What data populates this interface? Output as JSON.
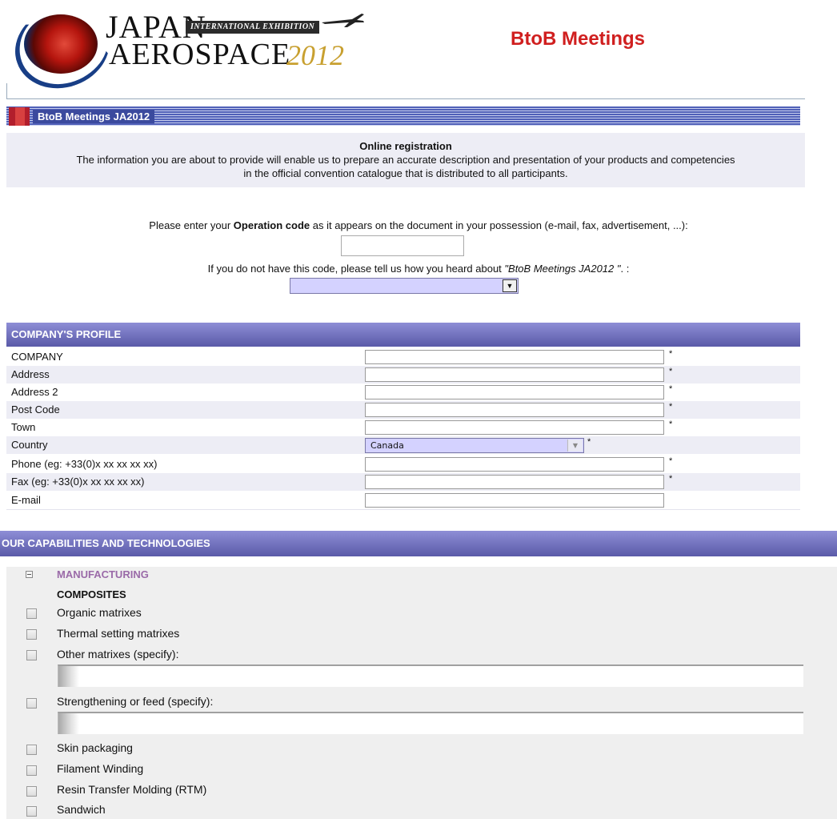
{
  "header": {
    "logo_japan": "JAPAN",
    "logo_international": "INTERNATIONAL EXHIBITION",
    "logo_aerospace": "AEROSPACE",
    "logo_year": "2012",
    "title": "BtoB Meetings",
    "title_color": "#d01f1f"
  },
  "section": {
    "title": "BtoB Meetings JA2012"
  },
  "intro": {
    "heading": "Online registration",
    "line1": "The information you are about to provide will enable us to prepare an accurate description and presentation of your products and competencies",
    "line2": "in the official convention catalogue that is distributed to all participants."
  },
  "opcode": {
    "prefix": "Please enter your ",
    "bold": "Operation code",
    "suffix": " as it appears on the document in your possession (e-mail, fax, advertisement, ...):",
    "value": ""
  },
  "heard": {
    "prefix": "If you do not have this code, please tell us how you heard about ",
    "italic": "\"BtoB Meetings JA2012 \"",
    "suffix": ". :",
    "selected": ""
  },
  "profile": {
    "header": "COMPANY'S PROFILE",
    "star": "*",
    "fields": [
      {
        "label": "COMPANY",
        "value": ""
      },
      {
        "label": "Address",
        "value": ""
      },
      {
        "label": "Address 2",
        "value": ""
      },
      {
        "label": "Post Code",
        "value": ""
      },
      {
        "label": "Town",
        "value": ""
      },
      {
        "label": "Country",
        "value": "Canada"
      },
      {
        "label": "Phone (eg: +33(0)x xx xx xx xx)",
        "value": ""
      },
      {
        "label": "Fax (eg: +33(0)x xx xx xx xx)",
        "value": ""
      },
      {
        "label": "E-mail",
        "value": ""
      }
    ]
  },
  "capabilities": {
    "header": "OUR CAPABILITIES AND TECHNOLOGIES",
    "category": "MANUFACTURING",
    "subcategory": "COMPOSITES",
    "items": [
      "Organic matrixes",
      "Thermal setting matrixes",
      "Other matrixes (specify):",
      "Strengthening or feed (specify):",
      "Skin packaging",
      "Filament Winding",
      "Resin Transfer Molding (RTM)",
      "Sandwich"
    ]
  }
}
